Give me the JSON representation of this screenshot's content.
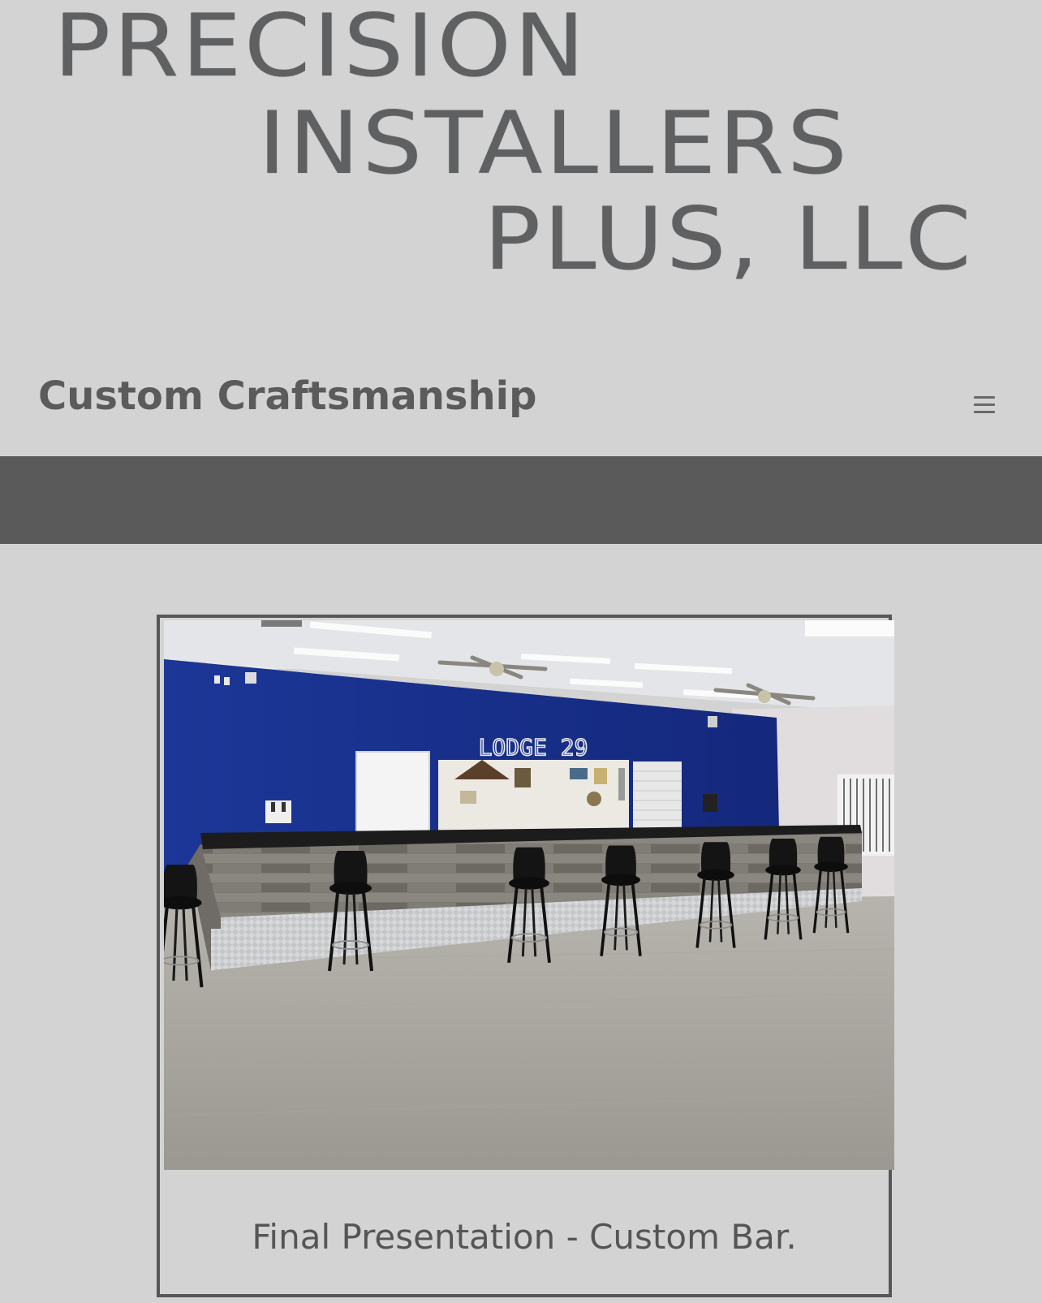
{
  "logo": {
    "line1": "PRECISION",
    "line2": "INSTALLERS",
    "line3": "PLUS, LLC"
  },
  "header": {
    "tagline": "Custom Craftsmanship",
    "menu_icon": "hamburger-menu-icon"
  },
  "gallery": {
    "caption": "Final Presentation - Custom Bar.",
    "photo_sign_text": "LODGE 29"
  },
  "colors": {
    "page_background": "#d3d3d3",
    "nav_bar": "#5a5a5a",
    "text": "#5b5b5b",
    "wall_blue": "#1a3296",
    "frame_border": "#575757"
  }
}
